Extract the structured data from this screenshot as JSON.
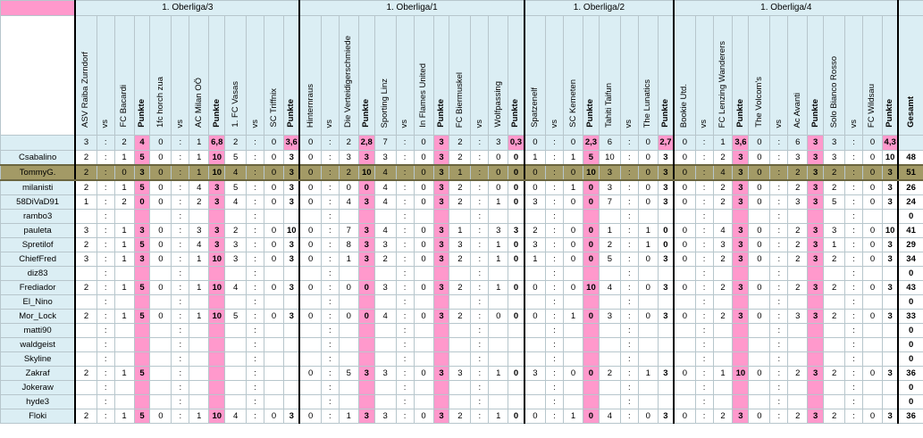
{
  "leagues": [
    "1. Oberliga/3",
    "1. Oberliga/1",
    "1. Oberliga/2",
    "1. Oberliga/4"
  ],
  "total_header": "Gesamt",
  "vs": "vs",
  "colon": ":",
  "punkte_label": "Punkte",
  "matches": [
    {
      "home": "ASV Raiba Zurndorf",
      "away": "FC Bacardi",
      "h": "3",
      "a": "2",
      "p": "4"
    },
    {
      "home": "1fc horch zua",
      "away": "AC Milan OÖ",
      "h": "0",
      "a": "1",
      "p": "6,8"
    },
    {
      "home": "1. FC Vasas",
      "away": "SC Triffnix",
      "h": "2",
      "a": "0",
      "p": "3,6"
    },
    {
      "home": "Hinternraus",
      "away": "Die Verteidigerschmiede",
      "h": "0",
      "a": "2",
      "p": "2,8"
    },
    {
      "home": "Sporting Linz",
      "away": "In Flames United",
      "h": "7",
      "a": "0",
      "p": "3"
    },
    {
      "home": "FC Biermuskel",
      "away": "Wolfpassing",
      "h": "2",
      "a": "3",
      "p": "0,3"
    },
    {
      "home": "Spatzenelf",
      "away": "SC Kemeten",
      "h": "0",
      "a": "0",
      "p": "2,3"
    },
    {
      "home": "Tahiti Taifun",
      "away": "The Lunatics",
      "h": "6",
      "a": "0",
      "p": "2,7"
    },
    {
      "home": "Bookie Utd.",
      "away": "FC Lenzing Wanderers",
      "h": "0",
      "a": "1",
      "p": "3,6"
    },
    {
      "home": "The Volcom's",
      "away": "Ac Avanti",
      "h": "0",
      "a": "6",
      "p": "3"
    },
    {
      "home": "Solo Bianco Rosso",
      "away": "FC Wildsau",
      "h": "3",
      "a": "0",
      "p": "4,3"
    }
  ],
  "players": [
    {
      "name": "Csabalino",
      "picks": [
        [
          "2",
          "1",
          "5"
        ],
        [
          "0",
          "1",
          "10"
        ],
        [
          "5",
          "0",
          "3"
        ],
        [
          "0",
          "3",
          "3"
        ],
        [
          "3",
          "0",
          "3"
        ],
        [
          "2",
          "0",
          "0"
        ],
        [
          "1",
          "1",
          "5"
        ],
        [
          "10",
          "0",
          "3"
        ],
        [
          "0",
          "2",
          "3"
        ],
        [
          "0",
          "3",
          "3"
        ],
        [
          "3",
          "0",
          "10"
        ]
      ],
      "total": "48"
    },
    {
      "name": "TommyG.",
      "picks": [
        [
          "2",
          "0",
          "3"
        ],
        [
          "0",
          "1",
          "10"
        ],
        [
          "4",
          "0",
          "3"
        ],
        [
          "0",
          "2",
          "10"
        ],
        [
          "4",
          "0",
          "3"
        ],
        [
          "1",
          "0",
          "0"
        ],
        [
          "0",
          "0",
          "10"
        ],
        [
          "3",
          "0",
          "3"
        ],
        [
          "0",
          "4",
          "3"
        ],
        [
          "0",
          "2",
          "3"
        ],
        [
          "2",
          "0",
          "3"
        ]
      ],
      "total": "51"
    },
    {
      "name": "milanisti",
      "picks": [
        [
          "2",
          "1",
          "5"
        ],
        [
          "0",
          "4",
          "3"
        ],
        [
          "5",
          "0",
          "3"
        ],
        [
          "0",
          "0",
          "0"
        ],
        [
          "4",
          "0",
          "3"
        ],
        [
          "2",
          "0",
          "0"
        ],
        [
          "0",
          "1",
          "0"
        ],
        [
          "3",
          "0",
          "3"
        ],
        [
          "0",
          "2",
          "3"
        ],
        [
          "0",
          "2",
          "3"
        ],
        [
          "2",
          "0",
          "3"
        ]
      ],
      "total": "26"
    },
    {
      "name": "58DiVaD91",
      "picks": [
        [
          "1",
          "2",
          "0"
        ],
        [
          "0",
          "2",
          "3"
        ],
        [
          "4",
          "0",
          "3"
        ],
        [
          "0",
          "4",
          "3"
        ],
        [
          "4",
          "0",
          "3"
        ],
        [
          "2",
          "1",
          "0"
        ],
        [
          "3",
          "0",
          "0"
        ],
        [
          "7",
          "0",
          "3"
        ],
        [
          "0",
          "2",
          "3"
        ],
        [
          "0",
          "3",
          "3"
        ],
        [
          "5",
          "0",
          "3"
        ]
      ],
      "total": "24"
    },
    {
      "name": "rambo3",
      "picks": [
        [
          "",
          "",
          ""
        ],
        [
          "",
          "",
          ""
        ],
        [
          "",
          "",
          ""
        ],
        [
          "",
          "",
          ""
        ],
        [
          "",
          "",
          ""
        ],
        [
          "",
          "",
          ""
        ],
        [
          "",
          "",
          ""
        ],
        [
          "",
          "",
          ""
        ],
        [
          "",
          "",
          ""
        ],
        [
          "",
          "",
          ""
        ],
        [
          "",
          "",
          ""
        ]
      ],
      "total": "0"
    },
    {
      "name": "pauleta",
      "picks": [
        [
          "3",
          "1",
          "3"
        ],
        [
          "0",
          "3",
          "3"
        ],
        [
          "2",
          "0",
          "10"
        ],
        [
          "0",
          "7",
          "3"
        ],
        [
          "4",
          "0",
          "3"
        ],
        [
          "1",
          "3",
          "3"
        ],
        [
          "2",
          "0",
          "0"
        ],
        [
          "1",
          "1",
          "0"
        ],
        [
          "0",
          "4",
          "3"
        ],
        [
          "0",
          "2",
          "3"
        ],
        [
          "3",
          "0",
          "10"
        ]
      ],
      "total": "41"
    },
    {
      "name": "Spretilof",
      "picks": [
        [
          "2",
          "1",
          "5"
        ],
        [
          "0",
          "4",
          "3"
        ],
        [
          "3",
          "0",
          "3"
        ],
        [
          "0",
          "8",
          "3"
        ],
        [
          "3",
          "0",
          "3"
        ],
        [
          "3",
          "1",
          "0"
        ],
        [
          "3",
          "0",
          "0"
        ],
        [
          "2",
          "1",
          "0"
        ],
        [
          "0",
          "3",
          "3"
        ],
        [
          "0",
          "2",
          "3"
        ],
        [
          "1",
          "0",
          "3"
        ]
      ],
      "total": "29"
    },
    {
      "name": "ChiefFred",
      "picks": [
        [
          "3",
          "1",
          "3"
        ],
        [
          "0",
          "1",
          "10"
        ],
        [
          "3",
          "0",
          "3"
        ],
        [
          "0",
          "1",
          "3"
        ],
        [
          "2",
          "0",
          "3"
        ],
        [
          "2",
          "1",
          "0"
        ],
        [
          "1",
          "0",
          "0"
        ],
        [
          "5",
          "0",
          "3"
        ],
        [
          "0",
          "2",
          "3"
        ],
        [
          "0",
          "2",
          "3"
        ],
        [
          "2",
          "0",
          "3"
        ]
      ],
      "total": "34"
    },
    {
      "name": "diz83",
      "picks": [
        [
          "",
          "",
          ""
        ],
        [
          "",
          "",
          ""
        ],
        [
          "",
          "",
          ""
        ],
        [
          "",
          "",
          ""
        ],
        [
          "",
          "",
          ""
        ],
        [
          "",
          "",
          ""
        ],
        [
          "",
          "",
          ""
        ],
        [
          "",
          "",
          ""
        ],
        [
          "",
          "",
          ""
        ],
        [
          "",
          "",
          ""
        ],
        [
          "",
          "",
          ""
        ]
      ],
      "total": "0"
    },
    {
      "name": "Frediador",
      "picks": [
        [
          "2",
          "1",
          "5"
        ],
        [
          "0",
          "1",
          "10"
        ],
        [
          "4",
          "0",
          "3"
        ],
        [
          "0",
          "0",
          "0"
        ],
        [
          "3",
          "0",
          "3"
        ],
        [
          "2",
          "1",
          "0"
        ],
        [
          "0",
          "0",
          "10"
        ],
        [
          "4",
          "0",
          "3"
        ],
        [
          "0",
          "2",
          "3"
        ],
        [
          "0",
          "2",
          "3"
        ],
        [
          "2",
          "0",
          "3"
        ]
      ],
      "total": "43"
    },
    {
      "name": "El_Nino",
      "picks": [
        [
          "",
          "",
          ""
        ],
        [
          "",
          "",
          ""
        ],
        [
          "",
          "",
          ""
        ],
        [
          "",
          "",
          ""
        ],
        [
          "",
          "",
          ""
        ],
        [
          "",
          "",
          ""
        ],
        [
          "",
          "",
          ""
        ],
        [
          "",
          "",
          ""
        ],
        [
          "",
          "",
          ""
        ],
        [
          "",
          "",
          ""
        ],
        [
          "",
          "",
          ""
        ]
      ],
      "total": "0"
    },
    {
      "name": "Mor_Lock",
      "picks": [
        [
          "2",
          "1",
          "5"
        ],
        [
          "0",
          "1",
          "10"
        ],
        [
          "5",
          "0",
          "3"
        ],
        [
          "0",
          "0",
          "0"
        ],
        [
          "4",
          "0",
          "3"
        ],
        [
          "2",
          "0",
          "0"
        ],
        [
          "0",
          "1",
          "0"
        ],
        [
          "3",
          "0",
          "3"
        ],
        [
          "0",
          "2",
          "3"
        ],
        [
          "0",
          "3",
          "3"
        ],
        [
          "2",
          "0",
          "3"
        ]
      ],
      "total": "33"
    },
    {
      "name": "matti90",
      "picks": [
        [
          "",
          "",
          ""
        ],
        [
          "",
          "",
          ""
        ],
        [
          "",
          "",
          ""
        ],
        [
          "",
          "",
          ""
        ],
        [
          "",
          "",
          ""
        ],
        [
          "",
          "",
          ""
        ],
        [
          "",
          "",
          ""
        ],
        [
          "",
          "",
          ""
        ],
        [
          "",
          "",
          ""
        ],
        [
          "",
          "",
          ""
        ],
        [
          "",
          "",
          ""
        ]
      ],
      "total": "0"
    },
    {
      "name": "waldgeist",
      "picks": [
        [
          "",
          "",
          ""
        ],
        [
          "",
          "",
          ""
        ],
        [
          "",
          "",
          ""
        ],
        [
          "",
          "",
          ""
        ],
        [
          "",
          "",
          ""
        ],
        [
          "",
          "",
          ""
        ],
        [
          "",
          "",
          ""
        ],
        [
          "",
          "",
          ""
        ],
        [
          "",
          "",
          ""
        ],
        [
          "",
          "",
          ""
        ],
        [
          "",
          "",
          ""
        ]
      ],
      "total": "0"
    },
    {
      "name": "Skyline",
      "picks": [
        [
          "",
          "",
          ""
        ],
        [
          "",
          "",
          ""
        ],
        [
          "",
          "",
          ""
        ],
        [
          "",
          "",
          ""
        ],
        [
          "",
          "",
          ""
        ],
        [
          "",
          "",
          ""
        ],
        [
          "",
          "",
          ""
        ],
        [
          "",
          "",
          ""
        ],
        [
          "",
          "",
          ""
        ],
        [
          "",
          "",
          ""
        ],
        [
          "",
          "",
          ""
        ]
      ],
      "total": "0"
    },
    {
      "name": "Zakraf",
      "picks": [
        [
          "2",
          "1",
          "5"
        ],
        [
          "",
          "",
          ""
        ],
        [
          "",
          "",
          ""
        ],
        [
          "0",
          "5",
          "3"
        ],
        [
          "3",
          "0",
          "3"
        ],
        [
          "3",
          "1",
          "0"
        ],
        [
          "3",
          "0",
          "0"
        ],
        [
          "2",
          "1",
          "3"
        ],
        [
          "0",
          "1",
          "10"
        ],
        [
          "0",
          "2",
          "3"
        ],
        [
          "2",
          "0",
          "3"
        ]
      ],
      "total": "36"
    },
    {
      "name": "Jokeraw",
      "picks": [
        [
          "",
          "",
          ""
        ],
        [
          "",
          "",
          ""
        ],
        [
          "",
          "",
          ""
        ],
        [
          "",
          "",
          ""
        ],
        [
          "",
          "",
          ""
        ],
        [
          "",
          "",
          ""
        ],
        [
          "",
          "",
          ""
        ],
        [
          "",
          "",
          ""
        ],
        [
          "",
          "",
          ""
        ],
        [
          "",
          "",
          ""
        ],
        [
          "",
          "",
          ""
        ]
      ],
      "total": "0"
    },
    {
      "name": "hyde3",
      "picks": [
        [
          "",
          "",
          ""
        ],
        [
          "",
          "",
          ""
        ],
        [
          "",
          "",
          ""
        ],
        [
          "",
          "",
          ""
        ],
        [
          "",
          "",
          ""
        ],
        [
          "",
          "",
          ""
        ],
        [
          "",
          "",
          ""
        ],
        [
          "",
          "",
          ""
        ],
        [
          "",
          "",
          ""
        ],
        [
          "",
          "",
          ""
        ],
        [
          "",
          "",
          ""
        ]
      ],
      "total": "0"
    },
    {
      "name": "Floki",
      "picks": [
        [
          "2",
          "1",
          "5"
        ],
        [
          "0",
          "1",
          "10"
        ],
        [
          "4",
          "0",
          "3"
        ],
        [
          "0",
          "1",
          "3"
        ],
        [
          "3",
          "0",
          "3"
        ],
        [
          "2",
          "1",
          "0"
        ],
        [
          "0",
          "1",
          "0"
        ],
        [
          "4",
          "0",
          "3"
        ],
        [
          "0",
          "2",
          "3"
        ],
        [
          "0",
          "2",
          "3"
        ],
        [
          "2",
          "0",
          "3"
        ]
      ],
      "total": "36"
    }
  ],
  "highlight_row": "TommyG.",
  "colors": {
    "header_bg": "#dbeef4",
    "points_bg": "#ff99cc",
    "highlight_bg": "#a39a66"
  }
}
